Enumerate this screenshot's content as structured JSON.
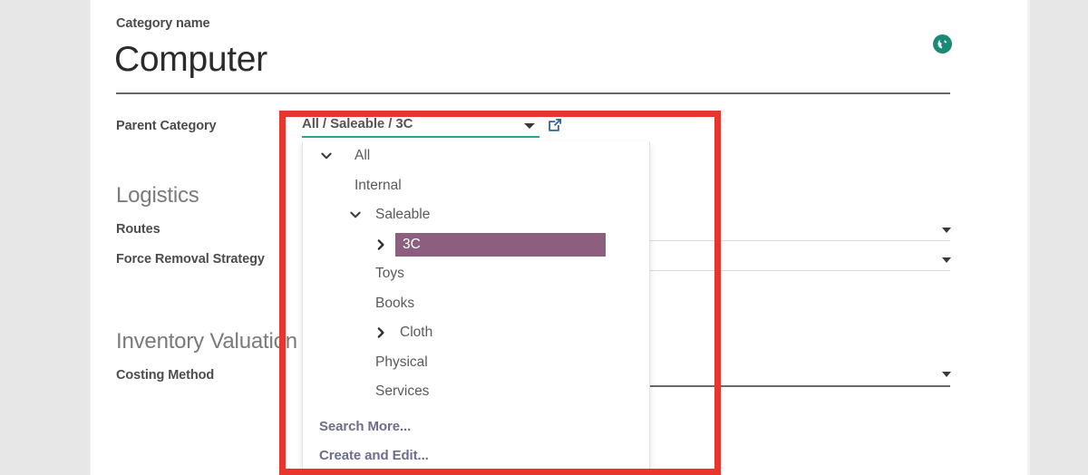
{
  "form": {
    "category_name_label": "Category name",
    "record_title": "Computer",
    "globe_icon": "globe-icon",
    "parent_category": {
      "label": "Parent Category",
      "value": "All / Saleable / 3C",
      "caret_icon": "chevron-down-icon",
      "external_link_icon": "external-link-icon"
    },
    "sections": [
      {
        "heading": "Logistics",
        "fields": [
          {
            "label": "Routes",
            "value": "",
            "caret_icon": "chevron-down-icon"
          },
          {
            "label": "Force Removal Strategy",
            "value": "",
            "caret_icon": "chevron-down-icon"
          }
        ]
      },
      {
        "heading": "Inventory Valuation",
        "fields": [
          {
            "label": "Costing Method",
            "value": "",
            "caret_icon": "chevron-down-icon"
          }
        ]
      }
    ]
  },
  "dropdown": {
    "items": [
      {
        "label": "All",
        "depth": 0,
        "toggle": "chevron-down-icon",
        "selected": false
      },
      {
        "label": "Internal",
        "depth": 1,
        "toggle": "none",
        "selected": false
      },
      {
        "label": "Saleable",
        "depth": 2,
        "toggle": "chevron-down-icon",
        "selected": false
      },
      {
        "label": "3C",
        "depth": 3,
        "toggle": "chevron-right-icon",
        "selected": true
      },
      {
        "label": "Toys",
        "depth": 2,
        "toggle": "none",
        "selected": false
      },
      {
        "label": "Books",
        "depth": 2,
        "toggle": "none",
        "selected": false
      },
      {
        "label": "Cloth",
        "depth": 3,
        "toggle": "chevron-right-icon",
        "selected": false
      },
      {
        "label": "Physical",
        "depth": 2,
        "toggle": "none",
        "selected": false
      },
      {
        "label": "Services",
        "depth": 2,
        "toggle": "none",
        "selected": false
      }
    ],
    "search_more": "Search More...",
    "create_and_edit": "Create and Edit..."
  },
  "annotation": {
    "highlight_color": "#e8352e"
  },
  "colors": {
    "accent_teal": "#22a89a",
    "selection_purple": "#8b5f7d",
    "globe_teal": "#1a8a77",
    "link_gray_blue": "#6d6d8c",
    "annotation_red": "#e8352e"
  }
}
